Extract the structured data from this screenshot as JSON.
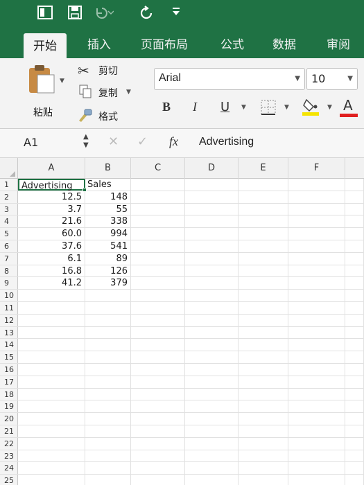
{
  "quick_access": {
    "save_icon": "save-icon",
    "undo_icon": "undo-icon",
    "redo_icon": "redo-icon",
    "customize_icon": "customize-icon"
  },
  "tabs": [
    {
      "label": "开始",
      "active": true
    },
    {
      "label": "插入"
    },
    {
      "label": "页面布局"
    },
    {
      "label": "公式"
    },
    {
      "label": "数据"
    },
    {
      "label": "审阅"
    }
  ],
  "ribbon": {
    "paste_label": "粘贴",
    "cut_label": "剪切",
    "copy_label": "复制",
    "format_label": "格式",
    "font_name": "Arial",
    "font_size": "10",
    "bold": "B",
    "italic": "I",
    "underline": "U",
    "font_color": "A",
    "accent_color": "#1f7244"
  },
  "formula_bar": {
    "name_box": "A1",
    "fx": "fx",
    "content": "Advertising"
  },
  "columns": [
    "A",
    "B",
    "C",
    "D",
    "E",
    "F"
  ],
  "rows": [
    {
      "n": "1",
      "a": "Advertising",
      "b": "Sales"
    },
    {
      "n": "2",
      "a": "12.5",
      "b": "148"
    },
    {
      "n": "3",
      "a": "3.7",
      "b": "55"
    },
    {
      "n": "4",
      "a": "21.6",
      "b": "338"
    },
    {
      "n": "5",
      "a": "60.0",
      "b": "994"
    },
    {
      "n": "6",
      "a": "37.6",
      "b": "541"
    },
    {
      "n": "7",
      "a": "6.1",
      "b": "89"
    },
    {
      "n": "8",
      "a": "16.8",
      "b": "126"
    },
    {
      "n": "9",
      "a": "41.2",
      "b": "379"
    },
    {
      "n": "10",
      "a": "",
      "b": ""
    },
    {
      "n": "11",
      "a": "",
      "b": ""
    },
    {
      "n": "12",
      "a": "",
      "b": ""
    },
    {
      "n": "13",
      "a": "",
      "b": ""
    },
    {
      "n": "14",
      "a": "",
      "b": ""
    },
    {
      "n": "15",
      "a": "",
      "b": ""
    },
    {
      "n": "16",
      "a": "",
      "b": ""
    },
    {
      "n": "17",
      "a": "",
      "b": ""
    },
    {
      "n": "18",
      "a": "",
      "b": ""
    },
    {
      "n": "19",
      "a": "",
      "b": ""
    },
    {
      "n": "20",
      "a": "",
      "b": ""
    },
    {
      "n": "21",
      "a": "",
      "b": ""
    },
    {
      "n": "22",
      "a": "",
      "b": ""
    },
    {
      "n": "23",
      "a": "",
      "b": ""
    },
    {
      "n": "24",
      "a": "",
      "b": ""
    },
    {
      "n": "25",
      "a": "",
      "b": ""
    }
  ]
}
